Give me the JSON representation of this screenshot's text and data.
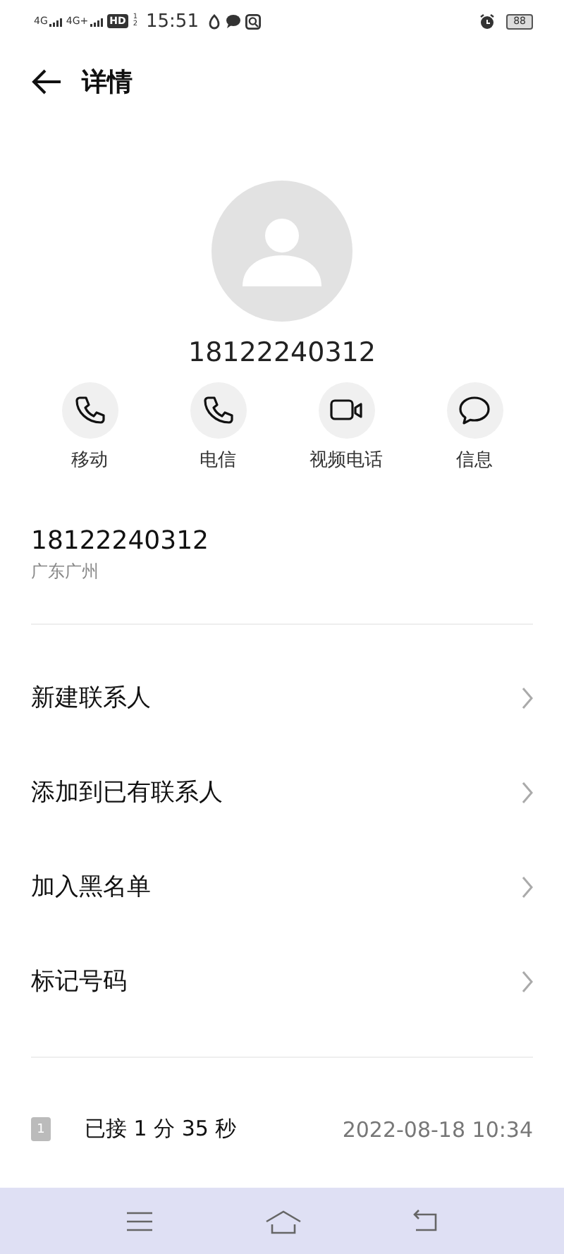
{
  "status_bar": {
    "signal_1": "4G",
    "signal_2": "4G+",
    "hd": "HD",
    "sim_slots": [
      "1",
      "2"
    ],
    "time": "15:51",
    "battery": "88"
  },
  "header": {
    "title": "详情"
  },
  "contact": {
    "number": "18122240312"
  },
  "actions": [
    {
      "kind": "call",
      "label": "移动"
    },
    {
      "kind": "call",
      "label": "电信"
    },
    {
      "kind": "video",
      "label": "视频电话"
    },
    {
      "kind": "message",
      "label": "信息"
    }
  ],
  "number_info": {
    "number": "18122240312",
    "location": "广东广州"
  },
  "menu": [
    {
      "label": "新建联系人"
    },
    {
      "label": "添加到已有联系人"
    },
    {
      "label": "加入黑名单"
    },
    {
      "label": "标记号码"
    }
  ],
  "call_log": [
    {
      "sim": "1",
      "status": "已接 1 分 35 秒",
      "time": "2022-08-18 10:34"
    }
  ]
}
